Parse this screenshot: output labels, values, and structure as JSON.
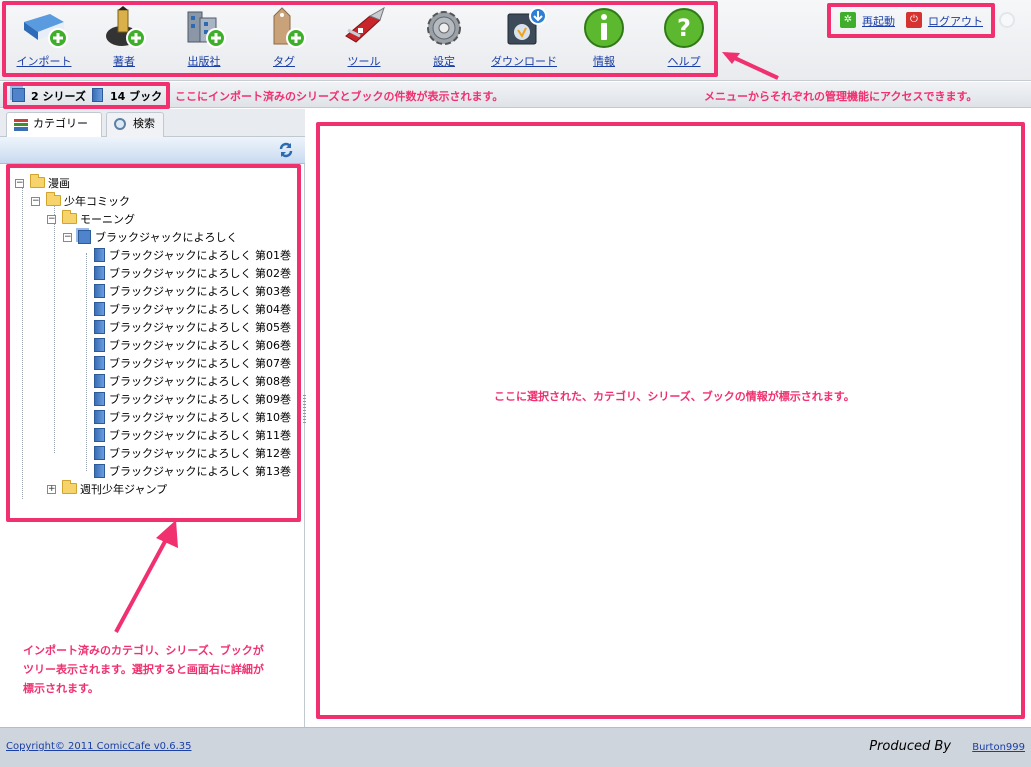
{
  "toolbar": {
    "items": [
      {
        "label": "インポート",
        "icon": "import-book-icon"
      },
      {
        "label": "著者",
        "icon": "author-pen-icon"
      },
      {
        "label": "出版社",
        "icon": "publisher-building-icon"
      },
      {
        "label": "タグ",
        "icon": "tag-icon"
      },
      {
        "label": "ツール",
        "icon": "tools-knife-icon"
      },
      {
        "label": "設定",
        "icon": "settings-gear-icon"
      },
      {
        "label": "ダウンロード",
        "icon": "download-disk-icon"
      },
      {
        "label": "情報",
        "icon": "info-icon"
      },
      {
        "label": "ヘルプ",
        "icon": "help-icon"
      }
    ],
    "restart_label": "再起動",
    "logout_label": "ログアウト"
  },
  "infobar": {
    "series_count": "2 シリーズ",
    "book_count": "14 ブック"
  },
  "annotations": {
    "counts": "ここにインポート済みのシリーズとブックの件数が表示されます。",
    "menu": "メニューからそれぞれの管理機能にアクセスできます。",
    "main": "ここに選択された、カテゴリ、シリーズ、ブックの情報が標示されます。",
    "tree_line1": "インポート済みのカテゴリ、シリーズ、ブックが",
    "tree_line2": "ツリー表示されます。選択すると画面右に詳細が",
    "tree_line3": "標示されます。"
  },
  "tabs": [
    {
      "label": "カテゴリー",
      "icon": "category-list-icon"
    },
    {
      "label": "検索",
      "icon": "search-icon"
    }
  ],
  "tree": {
    "root": "漫画",
    "sub": "少年コミック",
    "magazine": "モーニング",
    "series": "ブラックジャックによろしく",
    "books": [
      "ブラックジャックによろしく 第01巻",
      "ブラックジャックによろしく 第02巻",
      "ブラックジャックによろしく 第03巻",
      "ブラックジャックによろしく 第04巻",
      "ブラックジャックによろしく 第05巻",
      "ブラックジャックによろしく 第06巻",
      "ブラックジャックによろしく 第07巻",
      "ブラックジャックによろしく 第08巻",
      "ブラックジャックによろしく 第09巻",
      "ブラックジャックによろしく 第10巻",
      "ブラックジャックによろしく 第11巻",
      "ブラックジャックによろしく 第12巻",
      "ブラックジャックによろしく 第13巻"
    ],
    "other": "週刊少年ジャンプ"
  },
  "footer": {
    "copyright": "Copyright© 2011 ComicCafe v0.6.35",
    "produced_by": "Produced By",
    "author_link": "Burton999"
  },
  "colors": {
    "highlight": "#f0306f",
    "link": "#1a3fa6"
  }
}
